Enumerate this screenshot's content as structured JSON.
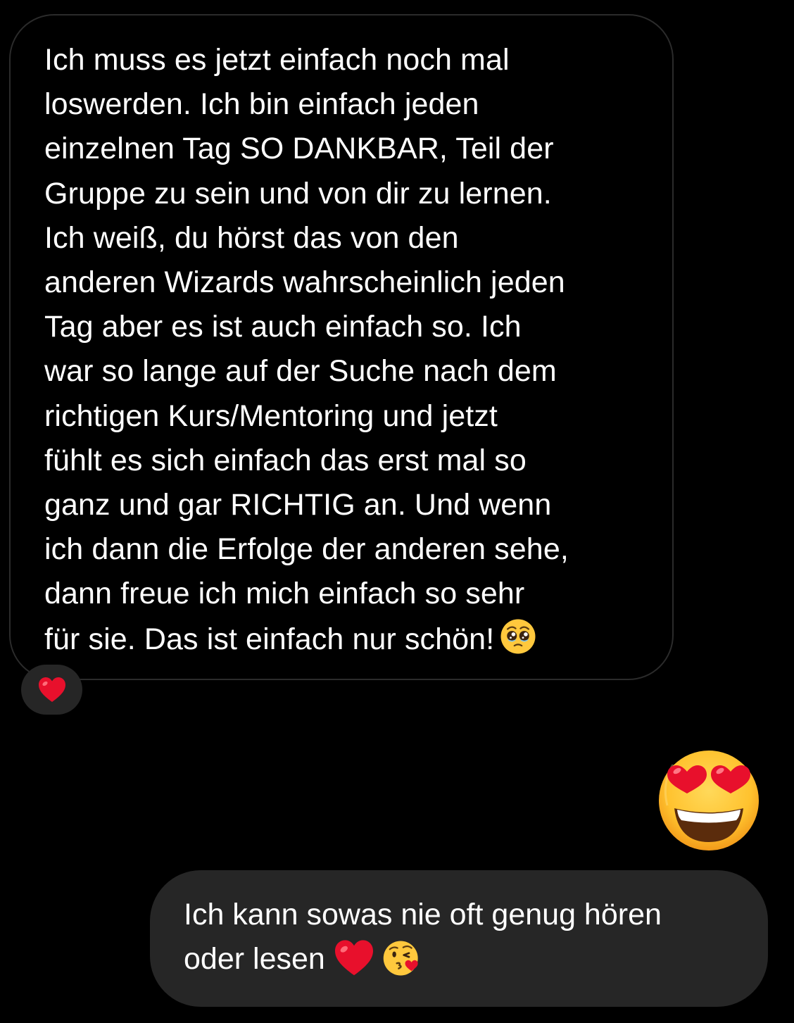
{
  "conversation": {
    "incoming_message": {
      "lines": [
        "Ich muss es jetzt einfach noch mal",
        "loswerden. Ich bin einfach jeden",
        "einzelnen Tag SO DANKBAR, Teil der",
        "Gruppe zu sein und von dir zu lernen.",
        "Ich weiß, du hörst das von den",
        "anderen Wizards wahrscheinlich jeden",
        "Tag aber es ist auch einfach so. Ich",
        "war so lange auf der Suche nach dem",
        "richtigen Kurs/Mentoring und jetzt",
        "fühlt es sich einfach das erst mal so",
        "ganz und gar RICHTIG an. Und wenn",
        "ich dann die Erfolge der anderen sehe,",
        "dann freue ich mich einfach so sehr",
        "für sie. Das ist einfach nur schön!"
      ],
      "trailing_emoji": "pleading-face",
      "reaction": "red-heart"
    },
    "sent_emoji": "smiling-face-with-heart-eyes",
    "outgoing_message": {
      "lines": [
        "Ich kann sowas nie oft genug hören",
        "oder lesen"
      ],
      "trailing_emojis": [
        "red-heart",
        "face-blowing-a-kiss"
      ]
    }
  },
  "colors": {
    "background": "#000000",
    "incoming_border": "#2b2b2b",
    "outgoing_bubble": "#262626",
    "reaction_pill": "#262626",
    "text": "#ffffff",
    "heart": "#e8102c",
    "emoji_face": "#ffc83d"
  }
}
